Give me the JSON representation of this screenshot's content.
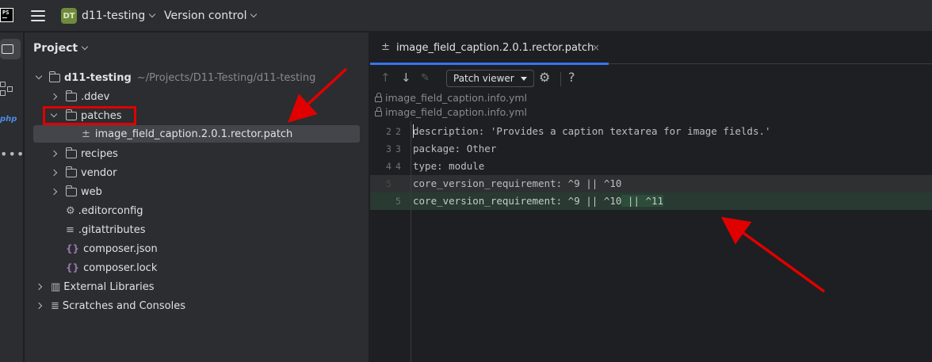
{
  "titlebar": {
    "app_logo": "PS",
    "project_badge": "DT",
    "project_name": "d11-testing",
    "version_control": "Version control"
  },
  "toolstrip": {
    "php_label": "php",
    "more": "•••"
  },
  "project_panel": {
    "title": "Project",
    "root": {
      "name": "d11-testing",
      "path": "~/Projects/D11-Testing/d11-testing"
    },
    "items": [
      {
        "label": ".ddev"
      },
      {
        "label": "patches"
      },
      {
        "label": "image_field_caption.2.0.1.rector.patch"
      },
      {
        "label": "recipes"
      },
      {
        "label": "vendor"
      },
      {
        "label": "web"
      },
      {
        "label": ".editorconfig"
      },
      {
        "label": ".gitattributes"
      },
      {
        "label": "composer.json"
      },
      {
        "label": "composer.lock"
      },
      {
        "label": "External Libraries"
      },
      {
        "label": "Scratches and Consoles"
      }
    ]
  },
  "editor": {
    "tab": {
      "label": "image_field_caption.2.0.1.rector.patch",
      "close": "×"
    },
    "toolbar": {
      "patch_viewer": "Patch viewer",
      "help": "?"
    },
    "file_paths": [
      "image_field_caption.info.yml",
      "image_field_caption.info.yml"
    ],
    "lines": [
      {
        "old": "2",
        "new": "2",
        "text": "description: 'Provides a caption textarea for image fields.'"
      },
      {
        "old": "3",
        "new": "3",
        "text": "package: Other"
      },
      {
        "old": "4",
        "new": "4",
        "text": "type: module"
      },
      {
        "old": "5",
        "new": "",
        "text": "core_version_requirement: ^9 || ^10"
      },
      {
        "old": "",
        "new": "5",
        "text": "core_version_requirement: ^9 || ^10",
        "added_text": " || ^11"
      }
    ]
  },
  "colors": {
    "highlight": "#e00000",
    "accent": "#3574f0",
    "added_bg": "#283a31"
  }
}
